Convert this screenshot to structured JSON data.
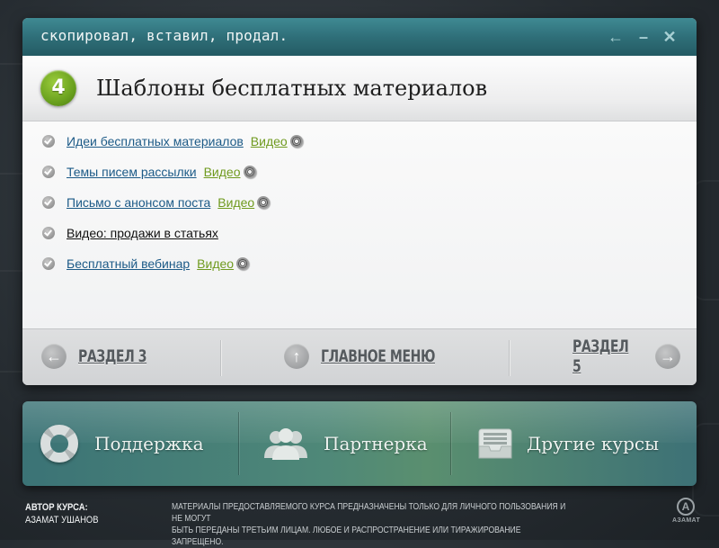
{
  "window": {
    "title": "скопировал, вставил, продал.",
    "controls": {
      "back_icon": "arrow-left-icon",
      "minimize_icon": "minimize-icon",
      "close_icon": "close-icon"
    }
  },
  "header": {
    "section_number": "4",
    "title": "Шаблоны бесплатных материалов"
  },
  "items": [
    {
      "label": "Идеи бесплатных материалов",
      "video": "Видео",
      "is_link": true
    },
    {
      "label": "Темы писем рассылки",
      "video": "Видео",
      "is_link": true
    },
    {
      "label": "Письмо с анонсом поста",
      "video": "Видео",
      "is_link": true
    },
    {
      "label": "Видео: продажи в статьях",
      "video": "",
      "is_link": false
    },
    {
      "label": "Бесплатный вебинар",
      "video": "Видео",
      "is_link": true
    }
  ],
  "nav": {
    "prev": "Раздел 3",
    "home": "Главное меню",
    "next": "Раздел 5"
  },
  "bottom": {
    "support": "Поддержка",
    "partner": "Партнерка",
    "courses": "Другие курсы"
  },
  "footer": {
    "author_label": "АВТОР КУРСА:",
    "author_name": "АЗАМАТ УШАНОВ",
    "disclaimer_line1": "МАТЕРИАЛЫ ПРЕДОСТАВЛЯЕМОГО КУРСА ПРЕДНАЗНАЧЕНЫ ТОЛЬКО ДЛЯ ЛИЧНОГО ПОЛЬЗОВАНИЯ И НЕ МОГУТ",
    "disclaimer_line2": "БЫТЬ ПЕРЕДАНЫ ТРЕТЬИМ ЛИЦАМ. ЛЮБОЕ И РАСПРОСТРАНЕНИЕ ИЛИ ТИРАЖИРОВАНИЕ ЗАПРЕЩЕНО.",
    "logo_text": "АЗАМАТ"
  },
  "colors": {
    "title_bar": "#2f6f79",
    "badge": "#6aa11e",
    "link": "#1c5a87",
    "video_link": "#6f9a1e"
  }
}
